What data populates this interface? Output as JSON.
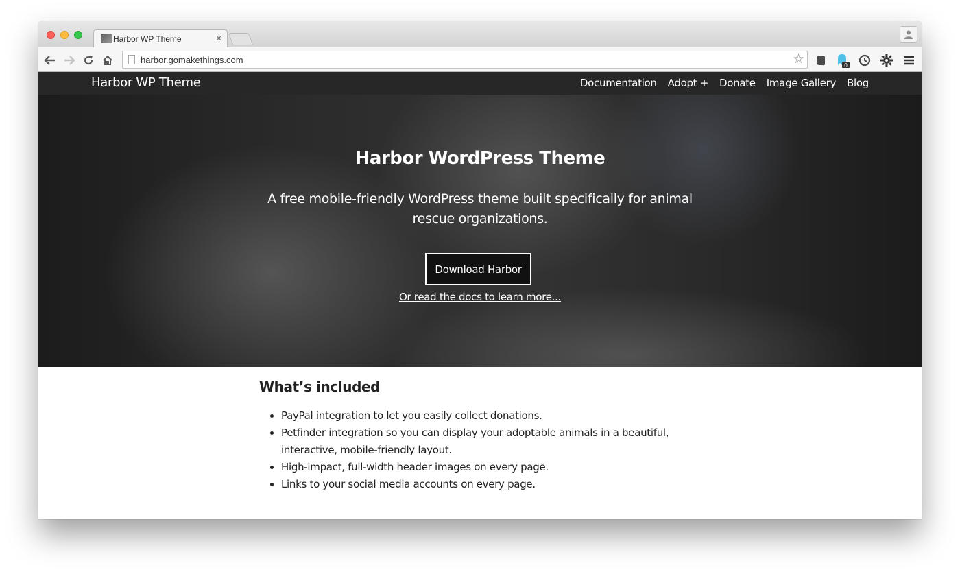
{
  "browser": {
    "tab_title": "Harbor WP Theme",
    "tab_close": "×",
    "url": "harbor.gomakethings.com",
    "extension_badge": "0"
  },
  "site": {
    "logo": "Harbor WP Theme",
    "nav": [
      "Documentation",
      "Adopt +",
      "Donate",
      "Image Gallery",
      "Blog"
    ]
  },
  "hero": {
    "title": "Harbor WordPress Theme",
    "subtitle": "A free mobile-friendly WordPress theme built specifically for animal rescue organizations.",
    "button": "Download Harbor",
    "link": "Or read the docs to learn more..."
  },
  "content": {
    "heading": "What’s included",
    "items": [
      "PayPal integration to let you easily collect donations.",
      "Petfinder integration so you can display your adoptable animals in a beautiful, interactive, mobile-friendly layout.",
      "High-impact, full-width header images on every page.",
      "Links to your social media accounts on every page."
    ]
  },
  "colors": {
    "nav_background": "#272727",
    "hero_overlay": "#1f1f1f",
    "text": "#222222"
  }
}
